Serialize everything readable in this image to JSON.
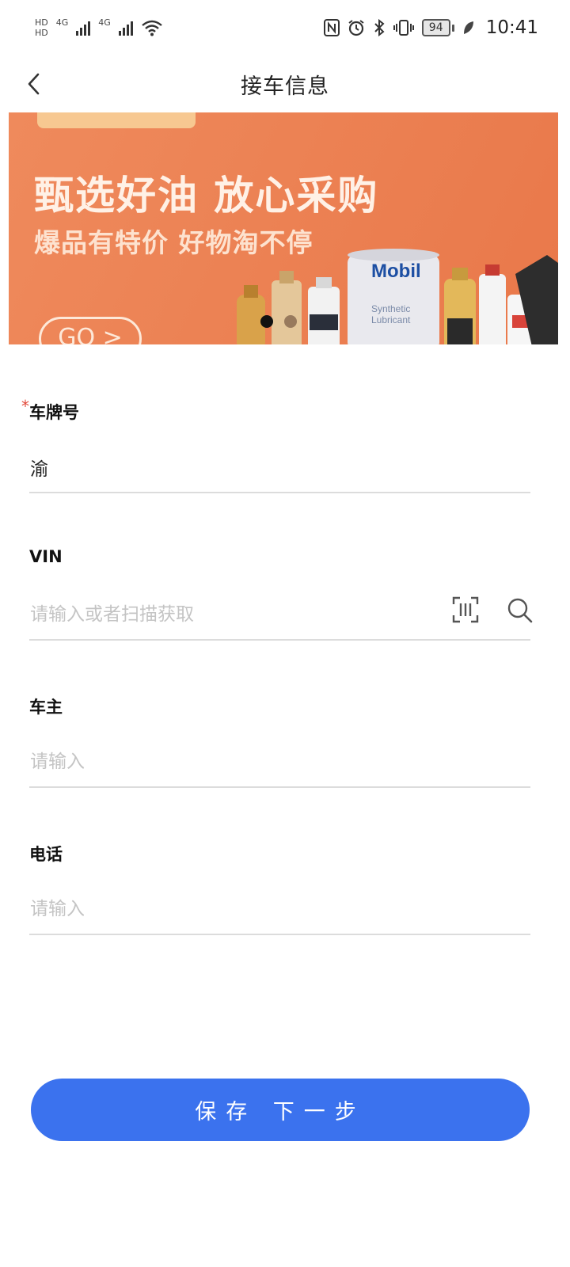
{
  "status_bar": {
    "hd_top": "HD",
    "hd_bottom": "HD",
    "net1": "4G",
    "net2": "4G",
    "battery": "94",
    "time": "10:41"
  },
  "header": {
    "title": "接车信息"
  },
  "banner": {
    "headline": "甄选好油 放心采购",
    "subline": "爆品有特价 好物淘不停",
    "go_label": "GO >",
    "product_brand": "Mobil",
    "product_text_1": "Synthetic",
    "product_text_2": "Lubricant",
    "page_count": 2,
    "active_page": 1
  },
  "form": {
    "plate": {
      "required_mark": "*",
      "label": "车牌号",
      "value": "渝"
    },
    "vin": {
      "label": "VIN",
      "placeholder": "请输入或者扫描获取"
    },
    "owner": {
      "label": "车主",
      "placeholder": "请输入"
    },
    "phone": {
      "label": "电话",
      "placeholder": "请输入"
    }
  },
  "actions": {
    "save_next_label": "保存 下一步"
  },
  "colors": {
    "primary": "#3b72ee",
    "banner": "#ec8254",
    "required": "#e24a3b",
    "divider": "#dcdcdc",
    "placeholder": "#c4c4c4"
  }
}
